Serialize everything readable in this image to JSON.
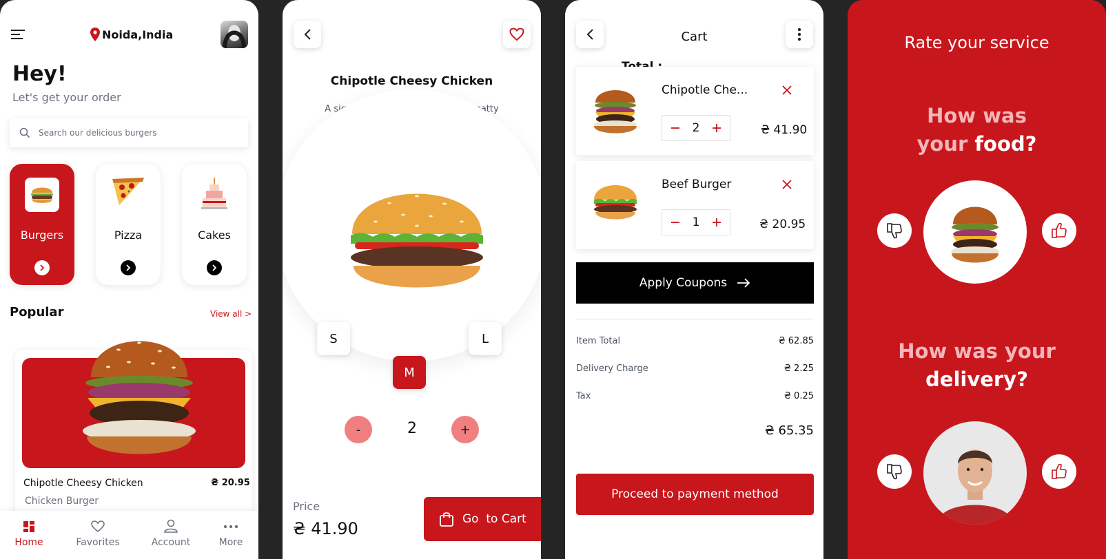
{
  "screen_home": {
    "location": "Noida,India",
    "greeting": "Hey!",
    "subtitle": "Let's get your order",
    "search_placeholder": "Search our delicious burgers",
    "categories": [
      {
        "label": "Burgers",
        "active": true
      },
      {
        "label": "Pizza",
        "active": false
      },
      {
        "label": "Cakes",
        "active": false
      }
    ],
    "popular_title": "Popular",
    "view_all": "View all >",
    "popular_item": {
      "name": "Chipotle Cheesy Chicken",
      "type": "Chicken Burger",
      "price": "₴ 20.95"
    },
    "nav": [
      {
        "label": "Home",
        "icon": "home-icon",
        "active": true
      },
      {
        "label": "Favorites",
        "icon": "heart-icon",
        "active": false
      },
      {
        "label": "Account",
        "icon": "user-icon",
        "active": false
      },
      {
        "label": "More",
        "icon": "more-icon",
        "active": false
      }
    ]
  },
  "screen_detail": {
    "title": "Chipotle Cheesy Chicken",
    "description": "A signature flame-grilled chicken patty topped with smoked beef",
    "sizes": [
      "S",
      "M",
      "L"
    ],
    "selected_size": "M",
    "qty_minus": "-",
    "quantity": "2",
    "qty_plus": "+",
    "price_label": "Price",
    "price": "₴ 41.90",
    "cart_button": "Go  to Cart"
  },
  "screen_cart": {
    "title": "Cart",
    "total_label": "Total :",
    "items": [
      {
        "name": "Chipotle Che...",
        "qty": "2",
        "price": "₴ 41.90"
      },
      {
        "name": "Beef Burger",
        "qty": "1",
        "price": "₴ 20.95"
      }
    ],
    "coupon_button": "Apply Coupons",
    "summary": [
      {
        "label": "Item Total",
        "value": "₴ 62.85"
      },
      {
        "label": "Delivery Charge",
        "value": "₴ 2.25"
      },
      {
        "label": "Tax",
        "value": "₴ 0.25"
      }
    ],
    "grand_total": "₴ 65.35",
    "proceed_button": "Proceed to payment method"
  },
  "screen_rate": {
    "title": "Rate your service",
    "q_food_1": "How was",
    "q_food_2a": "your",
    "q_food_2b": "food?",
    "q_delivery_1": "How was your",
    "q_delivery_2": "delivery?"
  },
  "colors": {
    "accent": "#c8161d",
    "accent_light": "#f08080",
    "dark": "#000000",
    "muted": "#6b7280"
  }
}
